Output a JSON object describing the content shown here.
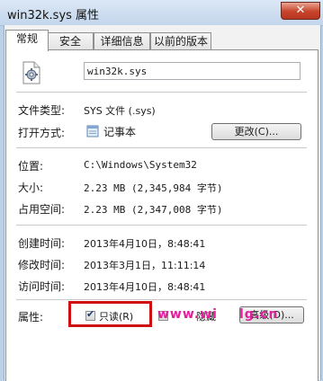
{
  "window": {
    "title": "win32k.sys 属性",
    "close_glyph": "✕"
  },
  "tabs": [
    {
      "label": "常规",
      "active": true
    },
    {
      "label": "安全",
      "active": false
    },
    {
      "label": "详细信息",
      "active": false
    },
    {
      "label": "以前的版本",
      "active": false
    }
  ],
  "general": {
    "file_name": "win32k.sys",
    "file_icon": "system-file-gear-icon",
    "file_type_label": "文件类型:",
    "file_type_value": "SYS 文件 (.sys)",
    "open_with_label": "打开方式:",
    "open_with_app": "记事本",
    "open_with_icon": "notepad-icon",
    "change_button": "更改(C)...",
    "location_label": "位置:",
    "location_value": "C:\\Windows\\System32",
    "size_label": "大小:",
    "size_value": "2.23 MB (2,345,984 字节)",
    "size_on_disk_label": "占用空间:",
    "size_on_disk_value": "2.23 MB (2,347,008 字节)",
    "created_label": "创建时间:",
    "created_value": "2013年4月10日，8:48:41",
    "modified_label": "修改时间:",
    "modified_value": "2013年3月1日，11:11:14",
    "accessed_label": "访问时间:",
    "accessed_value": "2013年4月10日，8:48:41",
    "attributes_label": "属性:",
    "readonly_label": "只读(R)",
    "readonly_checked": true,
    "hidden_label": "隐藏",
    "hidden_checked": false,
    "advanced_button": "高级(D)..."
  },
  "watermark": {
    "text_left": "www.wi",
    "text_right": "lg.cn",
    "color": "#e0209a"
  },
  "highlight_color": "#d01010"
}
